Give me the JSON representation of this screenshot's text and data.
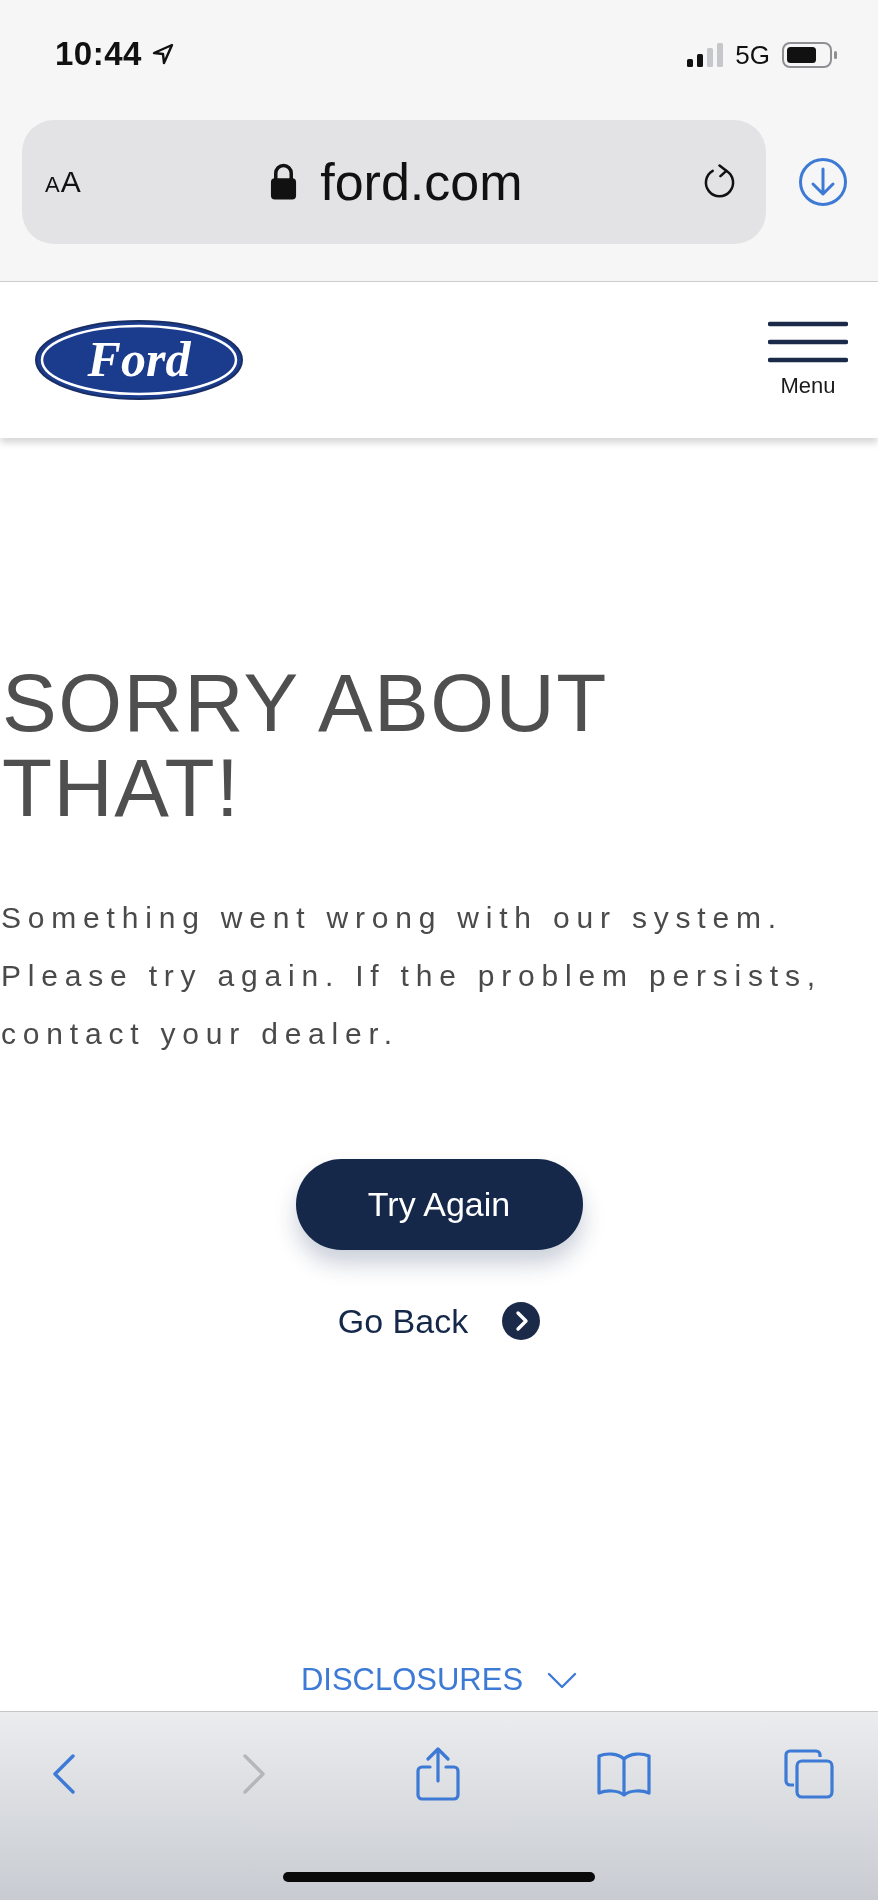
{
  "status_bar": {
    "time": "10:44",
    "network": "5G"
  },
  "address_bar": {
    "text_size_button": "AA",
    "url": "ford.com"
  },
  "site_header": {
    "logo_text": "Ford",
    "menu_label": "Menu"
  },
  "error": {
    "heading": "SORRY ABOUT THAT!",
    "message": "Something went wrong with our system. Please try again. If the problem persists, contact your dealer."
  },
  "actions": [
    {
      "kind": "primary",
      "label": "Try Again"
    },
    {
      "kind": "link",
      "label": "Go Back"
    }
  ],
  "footer": {
    "disclosures_label": "DISCLOSURES",
    "expanded": false
  },
  "toolbar": [
    {
      "kind": "back",
      "disabled": false
    },
    {
      "kind": "forward",
      "disabled": true
    },
    {
      "kind": "share",
      "disabled": false
    },
    {
      "kind": "bookmarks",
      "disabled": false
    },
    {
      "kind": "tabs",
      "disabled": false
    }
  ]
}
